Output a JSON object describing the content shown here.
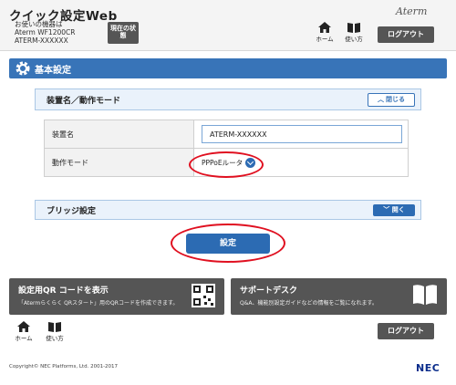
{
  "header": {
    "app_title": "クイック設定Web",
    "device_label": "お使いの機器は",
    "device_model": "Aterm WF1200CR",
    "device_name": "ATERM-XXXXXX",
    "status_button": "現在の状態",
    "brand": "Aterm",
    "home_label": "ホーム",
    "help_label": "使い方",
    "logout_label": "ログアウト"
  },
  "section": {
    "title": "基本設定"
  },
  "device_panel": {
    "title": "装置名／動作モード",
    "toggle_label": "閉じる",
    "rows": [
      {
        "label": "装置名",
        "value": "ATERM-XXXXXX"
      },
      {
        "label": "動作モード",
        "value": "PPPoEルータ"
      }
    ]
  },
  "bridge_panel": {
    "title": "ブリッジ設定",
    "toggle_label": "開く"
  },
  "set_button": "設定",
  "cards": [
    {
      "title": "設定用QR コードを表示",
      "desc": "「Atermらくらく QRスタート」用のQRコードを作成できます。",
      "icon": "qr-code-icon"
    },
    {
      "title": "サポートデスク",
      "desc": "Q&A、機能別設定ガイドなどの情報をご覧になれます。",
      "icon": "book-icon"
    }
  ],
  "footer": {
    "home_label": "ホーム",
    "help_label": "使い方",
    "logout_label": "ログアウト",
    "copyright": "Copyright© NEC Platforms, Ltd. 2001-2017",
    "logo": "NEC"
  },
  "colors": {
    "accent": "#3874b8",
    "button_dark": "#555555",
    "highlight": "#e01020"
  }
}
